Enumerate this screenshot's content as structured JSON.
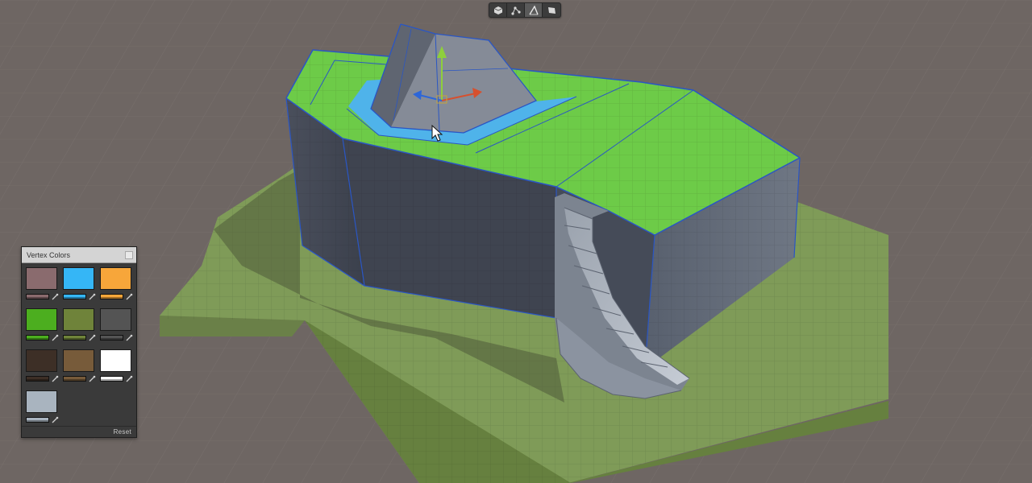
{
  "toolbar": {
    "modes": [
      {
        "icon": "cube-object-mode-icon",
        "active": false
      },
      {
        "icon": "vertex-mode-icon",
        "active": false
      },
      {
        "icon": "edge-mode-icon",
        "active": true
      },
      {
        "icon": "face-mode-icon",
        "active": false
      }
    ]
  },
  "panel": {
    "title": "Vertex Colors",
    "reset_label": "Reset",
    "swatches": [
      {
        "color": "#8a6b6e"
      },
      {
        "color": "#35b6f6"
      },
      {
        "color": "#f7a63a"
      },
      {
        "color": "#4cae1f"
      },
      {
        "color": "#6f833a"
      },
      {
        "color": "#545454"
      },
      {
        "color": "#3d2f26"
      },
      {
        "color": "#775b3a"
      },
      {
        "color": "#ffffff"
      },
      {
        "color": "#a9b4bf"
      }
    ]
  },
  "scene": {
    "ground_color": "#7f9b58",
    "grass_color": "#6dcb48",
    "water_color": "#4fb3ea",
    "stone_color": "#777e8a",
    "selection_color": "#2a56c4"
  }
}
